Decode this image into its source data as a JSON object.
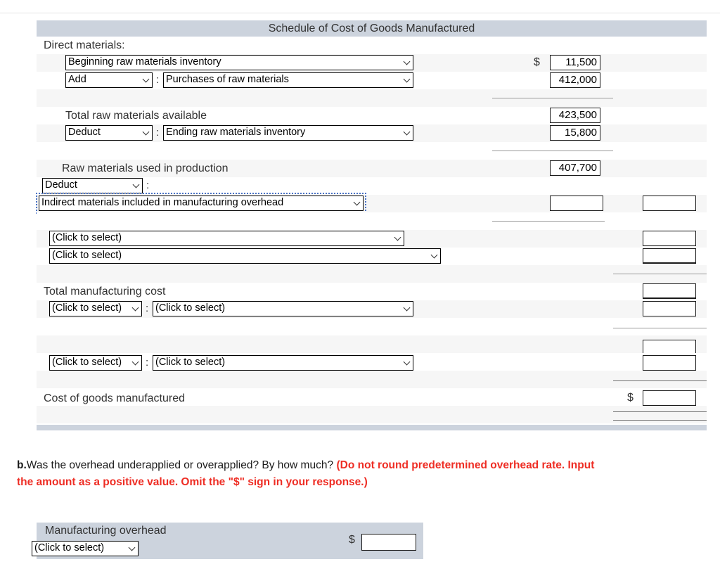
{
  "schedule": {
    "title": "Schedule of Cost of Goods Manufactured",
    "section_label": "Direct materials:",
    "labels": {
      "total_raw_available": "Total raw materials available",
      "raw_used": "Raw materials used in production",
      "total_mfg_cost": "Total manufacturing cost",
      "cogm": "Cost of goods manufactured"
    },
    "click_to_select": "(Click to select)",
    "colon": ":",
    "rows": [
      {
        "id": "beginning-raw",
        "select_main": "Beginning raw materials inventory",
        "amount": "11,500",
        "dollar": "$"
      },
      {
        "id": "purchases",
        "select_op": "Add",
        "select_main": "Purchases of raw materials",
        "amount": "412,000"
      },
      {
        "id": "total-raw-available",
        "amount": "423,500"
      },
      {
        "id": "ending-raw",
        "select_op": "Deduct",
        "select_main": "Ending raw materials inventory",
        "amount": "15,800"
      },
      {
        "id": "raw-used",
        "amount": "407,700"
      },
      {
        "id": "indirect-materials",
        "select_op": "Deduct",
        "select_main": "Indirect materials included in manufacturing overhead",
        "amount": "",
        "amount2": ""
      },
      {
        "id": "blank-select-1",
        "select_main": "(Click to select)",
        "amount2": ""
      },
      {
        "id": "blank-select-2",
        "select_main": "(Click to select)",
        "amount2": ""
      },
      {
        "id": "total-mfg-cost",
        "amount2": ""
      },
      {
        "id": "blank-pair-1",
        "select_op": "(Click to select)",
        "select_main": "(Click to select)",
        "amount2": ""
      },
      {
        "id": "blank-spacer",
        "amount2": ""
      },
      {
        "id": "blank-pair-2",
        "select_op": "(Click to select)",
        "select_main": "(Click to select)",
        "amount2": ""
      },
      {
        "id": "cogm",
        "amount2": "",
        "dollar": "$"
      }
    ]
  },
  "part_b": {
    "marker": "b.",
    "question": "Was the overhead underapplied or overapplied? By how much?",
    "instruction": "(Do not round predetermined overhead rate. Input the amount as a positive value. Omit the \"$\" sign in your response.)",
    "overhead_label": "Manufacturing overhead",
    "overhead_select": "(Click to select)",
    "dollar": "$",
    "overhead_value": ""
  },
  "colors": {
    "header_bar": "#ccd3dd",
    "alt_row": "#f6f6f6",
    "red_text": "#ee2d24",
    "focus_outline": "#4a72c4"
  }
}
